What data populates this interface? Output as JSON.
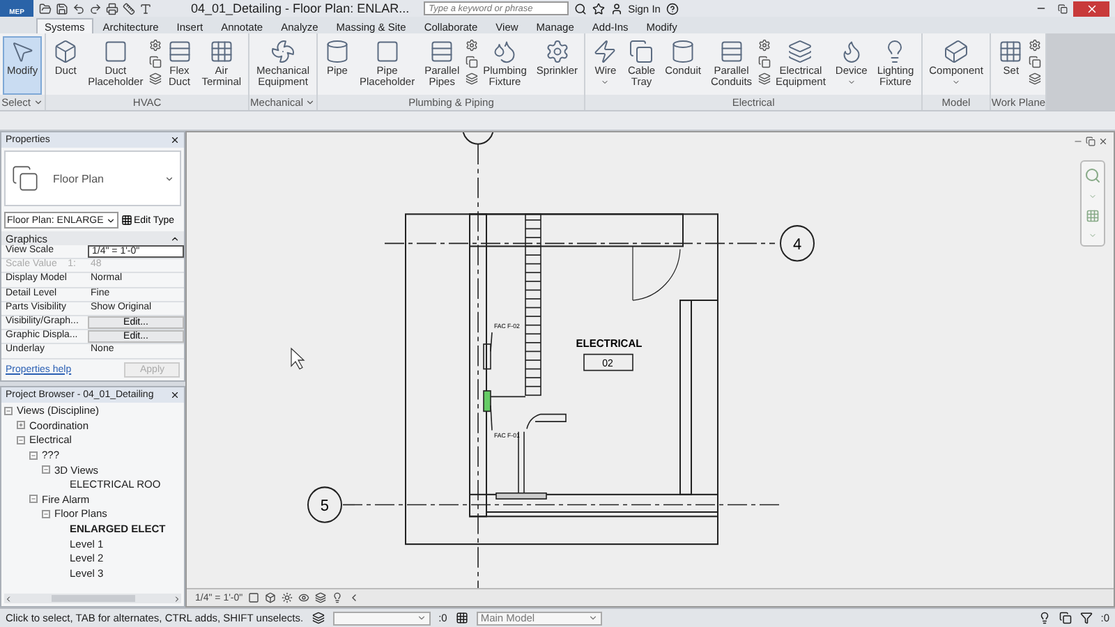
{
  "app": {
    "label": "MEP",
    "title": "04_01_Detailing - Floor Plan: ENLAR...",
    "search": {
      "placeholder": "Type a keyword or phrase"
    },
    "sign_in": "Sign In"
  },
  "tabs": [
    {
      "label": "Systems",
      "selected": true
    },
    {
      "label": "Architecture",
      "selected": false
    },
    {
      "label": "Insert",
      "selected": false
    },
    {
      "label": "Annotate",
      "selected": false
    },
    {
      "label": "Analyze",
      "selected": false
    },
    {
      "label": "Massing & Site",
      "selected": false
    },
    {
      "label": "Collaborate",
      "selected": false
    },
    {
      "label": "View",
      "selected": false
    },
    {
      "label": "Manage",
      "selected": false
    },
    {
      "label": "Add-Ins",
      "selected": false
    },
    {
      "label": "Modify",
      "selected": false
    }
  ],
  "ribbon": {
    "panels": [
      {
        "label": "Select",
        "menu": true,
        "tools": [
          {
            "kind": "large",
            "label": "Modify",
            "selected": true,
            "dropdown": false
          }
        ]
      },
      {
        "label": "HVAC",
        "menu": false,
        "tools": [
          {
            "kind": "large",
            "label": "Duct",
            "selected": false,
            "dropdown": false
          },
          {
            "kind": "large",
            "label": "Duct Placeholder",
            "selected": false,
            "dropdown": false
          },
          {
            "kind": "stack"
          },
          {
            "kind": "large",
            "label": "Flex Duct",
            "selected": false,
            "dropdown": false
          },
          {
            "kind": "large",
            "label": "Air Terminal",
            "selected": false,
            "dropdown": false
          }
        ]
      },
      {
        "label": "Mechanical",
        "menu": true,
        "tools": [
          {
            "kind": "large",
            "label": "Mechanical Equipment",
            "selected": false,
            "dropdown": false
          }
        ]
      },
      {
        "label": "Plumbing & Piping",
        "menu": false,
        "tools": [
          {
            "kind": "large",
            "label": "Pipe",
            "selected": false,
            "dropdown": false
          },
          {
            "kind": "large",
            "label": "Pipe Placeholder",
            "selected": false,
            "dropdown": false
          },
          {
            "kind": "large",
            "label": "Parallel Pipes",
            "selected": false,
            "dropdown": false
          },
          {
            "kind": "stack"
          },
          {
            "kind": "large",
            "label": "Plumbing Fixture",
            "selected": false,
            "dropdown": false
          },
          {
            "kind": "large",
            "label": "Sprinkler",
            "selected": false,
            "dropdown": false
          }
        ]
      },
      {
        "label": "Electrical",
        "menu": false,
        "tools": [
          {
            "kind": "large",
            "label": "Wire",
            "selected": false,
            "dropdown": true
          },
          {
            "kind": "large",
            "label": "Cable Tray",
            "selected": false,
            "dropdown": false
          },
          {
            "kind": "large",
            "label": "Conduit",
            "selected": false,
            "dropdown": false
          },
          {
            "kind": "large",
            "label": "Parallel Conduits",
            "selected": false,
            "dropdown": false
          },
          {
            "kind": "stack"
          },
          {
            "kind": "large",
            "label": "Electrical Equipment",
            "selected": false,
            "dropdown": false
          },
          {
            "kind": "large",
            "label": "Device",
            "selected": false,
            "dropdown": true
          },
          {
            "kind": "large",
            "label": "Lighting Fixture",
            "selected": false,
            "dropdown": false
          }
        ]
      },
      {
        "label": "Model",
        "menu": false,
        "tools": [
          {
            "kind": "large",
            "label": "Component",
            "selected": false,
            "dropdown": true
          }
        ]
      },
      {
        "label": "Work Plane",
        "menu": false,
        "tools": [
          {
            "kind": "large",
            "label": "Set",
            "selected": false,
            "dropdown": false
          },
          {
            "kind": "stack"
          }
        ]
      }
    ]
  },
  "properties": {
    "title": "Properties",
    "type": "Floor Plan",
    "selector": "Floor Plan: ENLARGE",
    "edit_type": "Edit Type",
    "section": "Graphics",
    "rows": [
      {
        "name": "View Scale",
        "value": "1/4\" = 1'-0\"",
        "kind": "field"
      },
      {
        "name": "Scale Value    1:",
        "value": "48",
        "kind": "readonly"
      },
      {
        "name": "Display Model",
        "value": "Normal",
        "kind": "text"
      },
      {
        "name": "Detail Level",
        "value": "Fine",
        "kind": "text"
      },
      {
        "name": "Parts Visibility",
        "value": "Show Original",
        "kind": "text"
      },
      {
        "name": "Visibility/Graph...",
        "value": "Edit...",
        "kind": "button"
      },
      {
        "name": "Graphic Displa...",
        "value": "Edit...",
        "kind": "button"
      },
      {
        "name": "Underlay",
        "value": "None",
        "kind": "text"
      }
    ],
    "help": "Properties help",
    "apply": {
      "label": "Apply",
      "disabled": true
    }
  },
  "project_browser": {
    "title": "Project Browser - 04_01_Detailing",
    "tree": [
      {
        "label": "Views (Discipline)",
        "expanded": true,
        "selected": false,
        "children": [
          {
            "label": "Coordination",
            "expanded": false,
            "selected": false
          },
          {
            "label": "Electrical",
            "expanded": true,
            "selected": false,
            "children": [
              {
                "label": "???",
                "expanded": true,
                "selected": false,
                "children": [
                  {
                    "label": "3D Views",
                    "expanded": true,
                    "selected": false,
                    "children": [
                      {
                        "label": "ELECTRICAL ROO",
                        "selected": false
                      }
                    ]
                  }
                ]
              },
              {
                "label": "Fire Alarm",
                "expanded": true,
                "selected": false,
                "children": [
                  {
                    "label": "Floor Plans",
                    "expanded": true,
                    "selected": false,
                    "children": [
                      {
                        "label": "ENLARGED ELECT",
                        "selected": true
                      },
                      {
                        "label": "Level 1",
                        "selected": false
                      },
                      {
                        "label": "Level 2",
                        "selected": false
                      },
                      {
                        "label": "Level 3",
                        "selected": false
                      }
                    ]
                  }
                ]
              }
            ]
          }
        ]
      }
    ]
  },
  "canvas": {
    "grids": [
      {
        "label": "4",
        "kind": "horizontal-right"
      },
      {
        "label": "5",
        "kind": "horizontal-left"
      }
    ],
    "room": {
      "name": "ELECTRICAL",
      "number": "02"
    },
    "tags": [
      "FAC F-02",
      "FAC F-01"
    ],
    "scale": "1/4\" = 1'-0\""
  },
  "status_bar": {
    "message": "Click to select, TAB for alternates, CTRL adds, SHIFT unselects.",
    "count": ":0",
    "model": "Main Model",
    "filter_count": ":0"
  }
}
